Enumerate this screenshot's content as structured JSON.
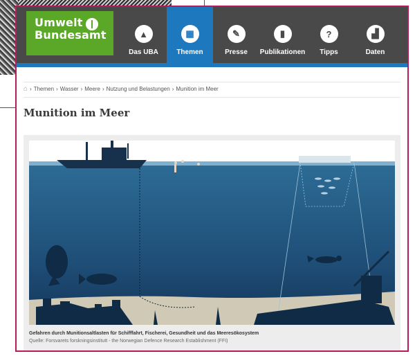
{
  "logo": {
    "line1": "Umwelt",
    "line2": "Bundesamt"
  },
  "nav": [
    {
      "label": "Das UBA",
      "icon": "building-icon",
      "glyph": "▲",
      "active": false
    },
    {
      "label": "Themen",
      "icon": "grid-icon",
      "glyph": "▦",
      "active": true
    },
    {
      "label": "Presse",
      "icon": "newspaper-icon",
      "glyph": "✎",
      "active": false
    },
    {
      "label": "Publikationen",
      "icon": "book-icon",
      "glyph": "▮",
      "active": false
    },
    {
      "label": "Tipps",
      "icon": "lightbulb-icon",
      "glyph": "?",
      "active": false
    },
    {
      "label": "Daten",
      "icon": "bar-chart-icon",
      "glyph": "▟",
      "active": false
    }
  ],
  "breadcrumb": [
    "Themen",
    "Wasser",
    "Meere",
    "Nutzung und Belastungen",
    "Munition im Meer"
  ],
  "page_title": "Munition im Meer",
  "figure": {
    "caption": "Gefahren durch Munitionsaltlasten für Schifffahrt, Fischerei, Gesundheit und das Meeresökosystem",
    "source": "Quelle: Forsvarets forskningsinstitutt - the Norwegian Defence Research Establishment (FFI)"
  },
  "colors": {
    "brand_green": "#5ba829",
    "nav_bg": "#494949",
    "nav_active": "#1d78be",
    "frame_border": "#b71c5a"
  }
}
